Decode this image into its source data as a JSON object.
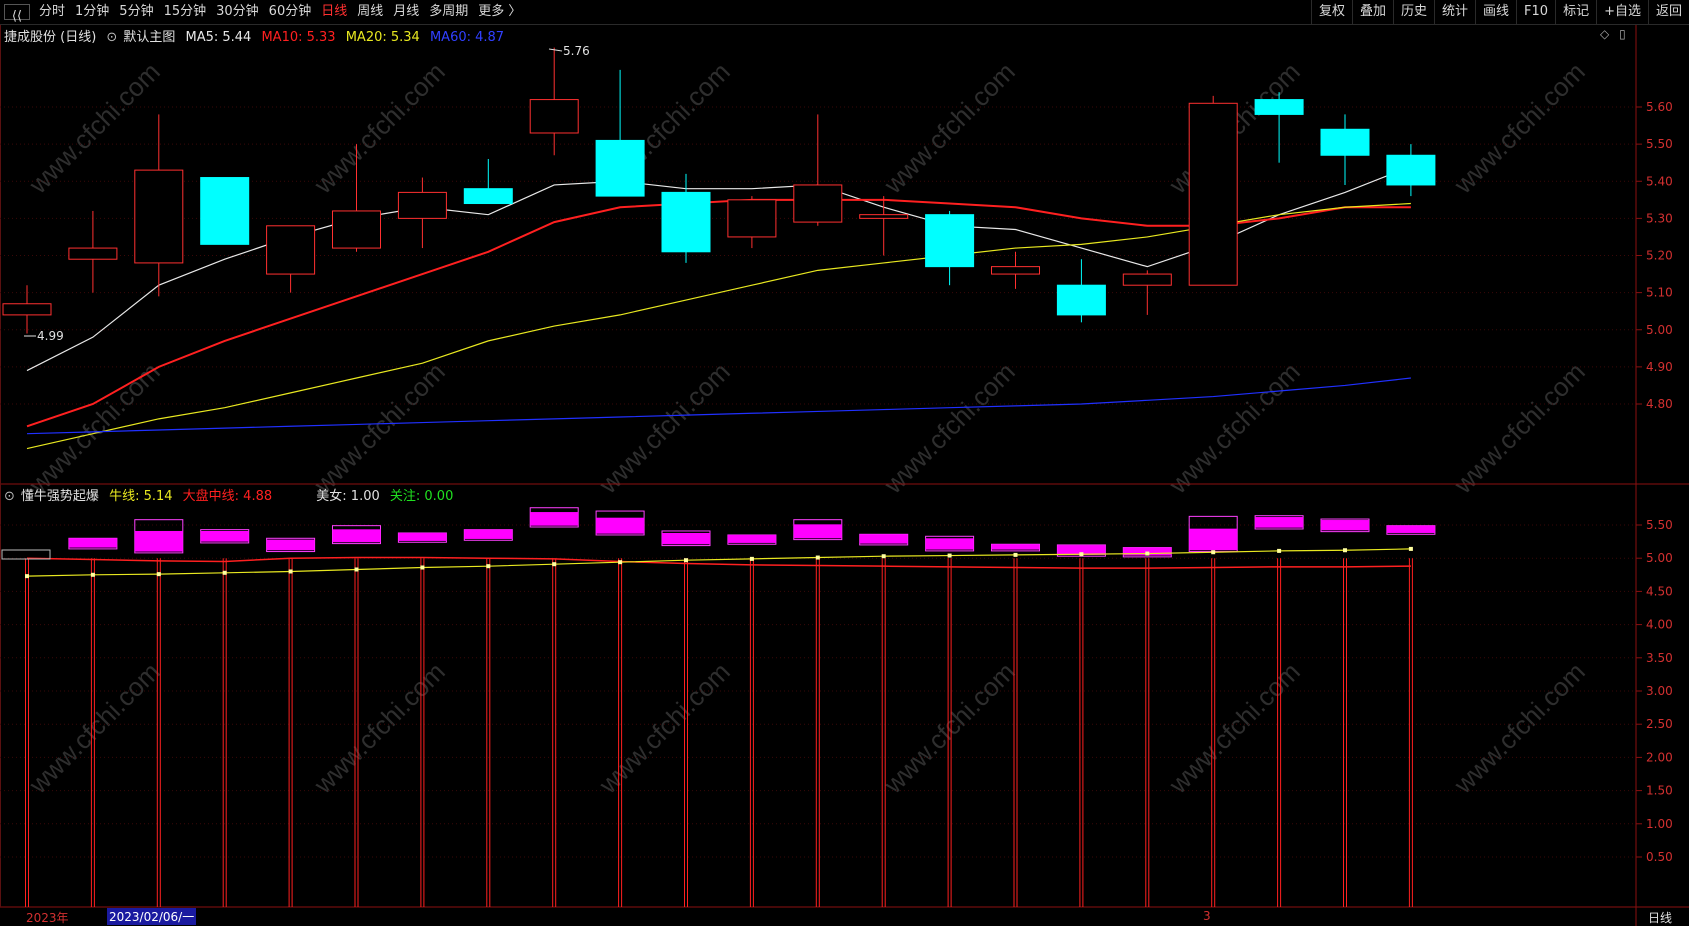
{
  "toolbar": {
    "back_glyph": "⟨⟨",
    "periods": [
      "分时",
      "1分钟",
      "5分钟",
      "15分钟",
      "30分钟",
      "60分钟",
      "日线",
      "周线",
      "月线",
      "多周期",
      "更多 〉"
    ],
    "active_period": "日线",
    "right_buttons": [
      "复权",
      "叠加",
      "历史",
      "统计",
      "画线",
      "F10",
      "标记",
      "+自选",
      "返回"
    ]
  },
  "main_legend": {
    "stock": "捷成股份 (日线)",
    "template": "默认主图",
    "ma5": "MA5: 5.44",
    "ma10": "MA10: 5.33",
    "ma20": "MA20: 5.34",
    "ma60": "MA60: 4.87",
    "colors": {
      "ma5": "#e8e8e8",
      "ma10": "#ff2020",
      "ma20": "#e8e820",
      "ma60": "#2030ff"
    }
  },
  "sub_legend": {
    "name": "懂牛强势起爆",
    "niu": "牛线: 5.14",
    "dapan": "大盘中线: 4.88",
    "meinv": "美女: 1.00",
    "guanzhu": "关注: 0.00"
  },
  "right_icons": {
    "diamond": "◇",
    "square": "▯"
  },
  "annotations": {
    "high": "5.76",
    "low": "4.99"
  },
  "bottom": {
    "year": "2023年",
    "date": "2023/02/06/一",
    "month_mark": "3",
    "period": "日线"
  },
  "watermark": "www.cfchi.com",
  "chart_data": [
    {
      "type": "candlestick",
      "title": "捷成股份 (日线)",
      "ylim": [
        4.7,
        5.73
      ],
      "yticks": [
        "5.60",
        "5.50",
        "5.40",
        "5.30",
        "5.20",
        "5.10",
        "5.00",
        "4.90",
        "4.80"
      ],
      "candles": [
        {
          "o": 5.04,
          "h": 5.12,
          "l": 4.99,
          "c": 5.07
        },
        {
          "o": 5.19,
          "h": 5.32,
          "l": 5.1,
          "c": 5.22
        },
        {
          "o": 5.18,
          "h": 5.58,
          "l": 5.09,
          "c": 5.43
        },
        {
          "o": 5.41,
          "h": 5.41,
          "l": 5.23,
          "c": 5.23
        },
        {
          "o": 5.15,
          "h": 5.28,
          "l": 5.1,
          "c": 5.28
        },
        {
          "o": 5.22,
          "h": 5.5,
          "l": 5.21,
          "c": 5.32
        },
        {
          "o": 5.3,
          "h": 5.41,
          "l": 5.22,
          "c": 5.37
        },
        {
          "o": 5.38,
          "h": 5.46,
          "l": 5.34,
          "c": 5.34
        },
        {
          "o": 5.53,
          "h": 5.76,
          "l": 5.47,
          "c": 5.62
        },
        {
          "o": 5.51,
          "h": 5.7,
          "l": 5.36,
          "c": 5.36
        },
        {
          "o": 5.37,
          "h": 5.42,
          "l": 5.18,
          "c": 5.21
        },
        {
          "o": 5.25,
          "h": 5.36,
          "l": 5.22,
          "c": 5.35
        },
        {
          "o": 5.29,
          "h": 5.58,
          "l": 5.28,
          "c": 5.39
        },
        {
          "o": 5.3,
          "h": 5.36,
          "l": 5.2,
          "c": 5.31
        },
        {
          "o": 5.31,
          "h": 5.32,
          "l": 5.12,
          "c": 5.17
        },
        {
          "o": 5.15,
          "h": 5.21,
          "l": 5.11,
          "c": 5.17
        },
        {
          "o": 5.12,
          "h": 5.19,
          "l": 5.02,
          "c": 5.04
        },
        {
          "o": 5.12,
          "h": 5.16,
          "l": 5.04,
          "c": 5.15
        },
        {
          "o": 5.12,
          "h": 5.63,
          "l": 5.12,
          "c": 5.61
        },
        {
          "o": 5.62,
          "h": 5.64,
          "l": 5.45,
          "c": 5.58
        },
        {
          "o": 5.54,
          "h": 5.58,
          "l": 5.39,
          "c": 5.47
        },
        {
          "o": 5.47,
          "h": 5.5,
          "l": 5.36,
          "c": 5.39
        }
      ],
      "series": [
        {
          "name": "MA5",
          "values": [
            4.89,
            4.98,
            5.12,
            5.19,
            5.25,
            5.3,
            5.33,
            5.31,
            5.39,
            5.4,
            5.38,
            5.38,
            5.39,
            5.33,
            5.28,
            5.27,
            5.22,
            5.17,
            5.23,
            5.31,
            5.37,
            5.44
          ]
        },
        {
          "name": "MA10",
          "values": [
            4.74,
            4.8,
            4.9,
            4.97,
            5.03,
            5.09,
            5.15,
            5.21,
            5.29,
            5.33,
            5.34,
            5.35,
            5.35,
            5.35,
            5.34,
            5.33,
            5.3,
            5.28,
            5.28,
            5.3,
            5.33,
            5.33
          ]
        },
        {
          "name": "MA20",
          "values": [
            4.68,
            4.72,
            4.76,
            4.79,
            4.83,
            4.87,
            4.91,
            4.97,
            5.01,
            5.04,
            5.08,
            5.12,
            5.16,
            5.18,
            5.2,
            5.22,
            5.23,
            5.25,
            5.28,
            5.31,
            5.33,
            5.34
          ]
        },
        {
          "name": "MA60",
          "values": [
            4.72,
            4.725,
            4.73,
            4.735,
            4.74,
            4.745,
            4.75,
            4.755,
            4.76,
            4.765,
            4.77,
            4.775,
            4.78,
            4.785,
            4.79,
            4.795,
            4.8,
            4.81,
            4.82,
            4.835,
            4.85,
            4.87
          ]
        }
      ]
    },
    {
      "type": "bar",
      "title": "懂牛强势起爆",
      "ylim": [
        0,
        5.9
      ],
      "yticks": [
        "5.50",
        "5.00",
        "4.50",
        "4.00",
        "3.50",
        "3.00",
        "2.50",
        "2.00",
        "1.50",
        "1.00",
        "0.50"
      ],
      "boxes": [
        {
          "lo": 5.14,
          "hi": 5.3
        },
        {
          "lo": 5.08,
          "hi": 5.58
        },
        {
          "lo": 5.23,
          "hi": 5.43
        },
        {
          "lo": 5.1,
          "hi": 5.3
        },
        {
          "lo": 5.22,
          "hi": 5.49
        },
        {
          "lo": 5.24,
          "hi": 5.38
        },
        {
          "lo": 5.27,
          "hi": 5.43
        },
        {
          "lo": 5.47,
          "hi": 5.76
        },
        {
          "lo": 5.35,
          "hi": 5.71
        },
        {
          "lo": 5.19,
          "hi": 5.41
        },
        {
          "lo": 5.21,
          "hi": 5.35
        },
        {
          "lo": 5.28,
          "hi": 5.58
        },
        {
          "lo": 5.2,
          "hi": 5.36
        },
        {
          "lo": 5.11,
          "hi": 5.33
        },
        {
          "lo": 5.11,
          "hi": 5.21
        },
        {
          "lo": 5.03,
          "hi": 5.2
        },
        {
          "lo": 5.02,
          "hi": 5.16
        },
        {
          "lo": 5.1,
          "hi": 5.63
        },
        {
          "lo": 5.44,
          "hi": 5.64
        },
        {
          "lo": 5.4,
          "hi": 5.59
        },
        {
          "lo": 5.36,
          "hi": 5.49
        }
      ],
      "series": [
        {
          "name": "牛线",
          "values": [
            4.73,
            4.75,
            4.76,
            4.78,
            4.8,
            4.83,
            4.86,
            4.88,
            4.91,
            4.94,
            4.97,
            4.99,
            5.01,
            5.03,
            5.04,
            5.05,
            5.06,
            5.07,
            5.09,
            5.11,
            5.12,
            5.14
          ]
        },
        {
          "name": "大盘中线",
          "values": [
            5.0,
            4.98,
            4.96,
            4.95,
            5.0,
            5.01,
            5.01,
            5.0,
            4.99,
            4.95,
            4.92,
            4.9,
            4.89,
            4.88,
            4.87,
            4.86,
            4.85,
            4.85,
            4.86,
            4.87,
            4.87,
            4.88
          ]
        }
      ]
    }
  ]
}
